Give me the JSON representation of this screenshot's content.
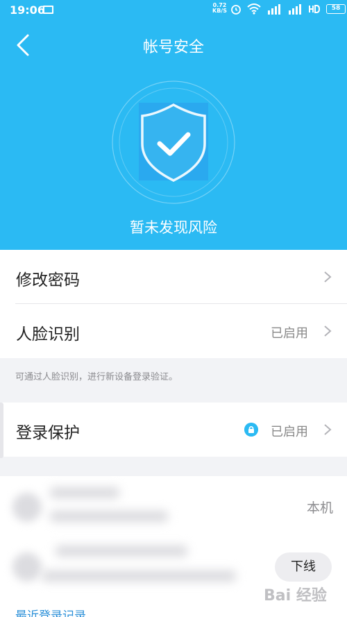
{
  "status_bar": {
    "time": "19:06",
    "net_speed_value": "0.72",
    "net_speed_unit": "KB/S",
    "battery": "58"
  },
  "header": {
    "title": "帐号安全"
  },
  "hero": {
    "status_text": "暂未发现风险"
  },
  "settings": {
    "change_password": {
      "label": "修改密码"
    },
    "face_recognition": {
      "label": "人脸识别",
      "value": "已启用"
    },
    "face_hint": "可通过人脸识别，进行新设备登录验证。",
    "login_protection": {
      "label": "登录保护",
      "value": "已启用"
    }
  },
  "devices": {
    "current_label": "本机",
    "offline_button": "下线",
    "recent_link": "最近登录记录..."
  },
  "watermark": "Bai 经验",
  "colors": {
    "accent": "#2bbaf3",
    "link": "#2a8fd8"
  }
}
